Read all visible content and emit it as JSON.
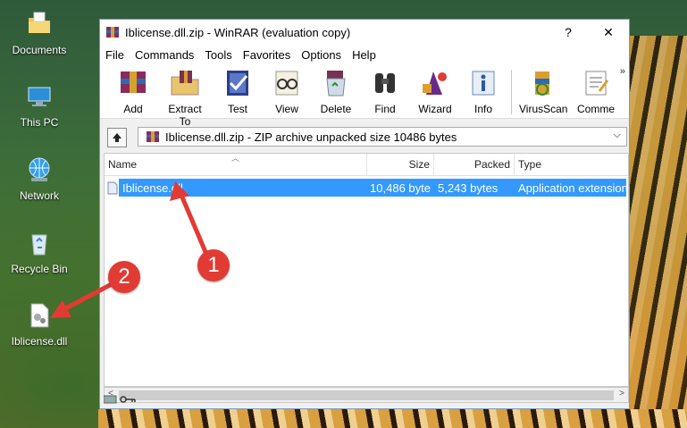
{
  "desktop": {
    "icons": [
      {
        "label": "Documents",
        "icon": "folder-icon"
      },
      {
        "label": "This PC",
        "icon": "computer-icon"
      },
      {
        "label": "Network",
        "icon": "network-icon"
      },
      {
        "label": "Recycle Bin",
        "icon": "recycle-bin-icon"
      },
      {
        "label": "Iblicense.dll",
        "icon": "dll-file-icon"
      }
    ]
  },
  "window": {
    "title": "Iblicense.dll.zip - WinRAR (evaluation copy)",
    "help_button": "?",
    "close_button": "✕",
    "menu": [
      "File",
      "Commands",
      "Tools",
      "Favorites",
      "Options",
      "Help"
    ],
    "toolbar": [
      "Add",
      "Extract To",
      "Test",
      "View",
      "Delete",
      "Find",
      "Wizard",
      "Info",
      "VirusScan",
      "Comme"
    ],
    "toolbar_more": "»",
    "address": "Iblicense.dll.zip - ZIP archive unpacked size 10486 bytes",
    "columns": [
      "Name",
      "Size",
      "Packed",
      "Type"
    ],
    "files": [
      {
        "name": "Iblicense.dll",
        "size": "10,486 byte",
        "packed": "5,243 bytes",
        "type": "Application extension"
      }
    ]
  },
  "annotations": [
    "1",
    "2"
  ],
  "colors": {
    "selection": "#3399ff",
    "badge": "#e23b34"
  }
}
